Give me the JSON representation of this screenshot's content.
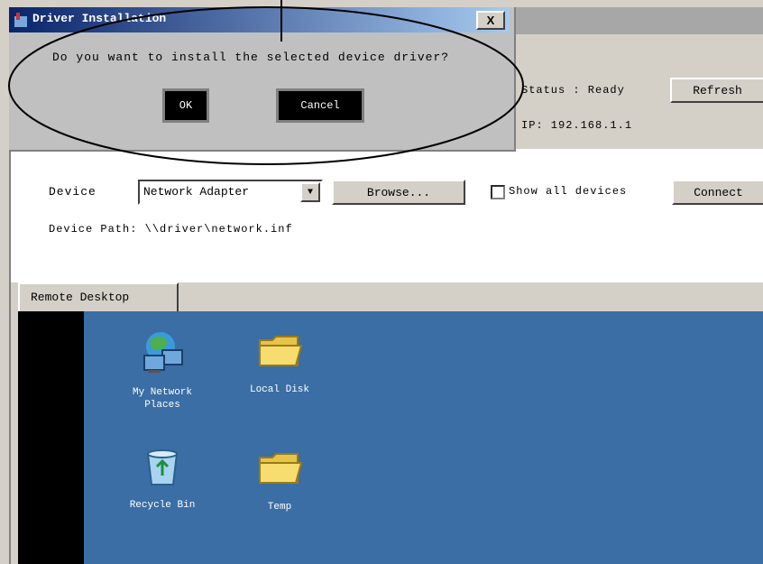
{
  "dialog": {
    "title": "Driver Installation",
    "close_label": "X",
    "message": "Do you want to install the selected device driver?",
    "ok_label": "OK",
    "cancel_label": "Cancel"
  },
  "main": {
    "status_label": "Status : Ready",
    "address_label": "IP: 192.168.1.1",
    "refresh_label": "Refresh",
    "device_label": "Device",
    "device_selected": "Network Adapter",
    "browse_label": "Browse...",
    "checkbox_label": "Show all devices",
    "connect_label": "Connect",
    "path_label": "Device Path: \\\\driver\\network.inf",
    "tab_label": "Remote Desktop"
  },
  "desktop": {
    "icons": [
      {
        "label_line1": "My Network",
        "label_line2": "Places",
        "icon": "network-places-icon"
      },
      {
        "label_line1": "Local Disk",
        "label_line2": "",
        "icon": "folder-icon"
      },
      {
        "label_line1": "Recycle Bin",
        "label_line2": "",
        "icon": "recycle-bin-icon"
      },
      {
        "label_line1": "Temp",
        "label_line2": "",
        "icon": "folder-icon"
      }
    ]
  },
  "colors": {
    "desktop_bg": "#3a6ea5",
    "titlebar_start": "#0a246a",
    "titlebar_end": "#a6caf0",
    "window_bg": "#d4d0c8"
  }
}
